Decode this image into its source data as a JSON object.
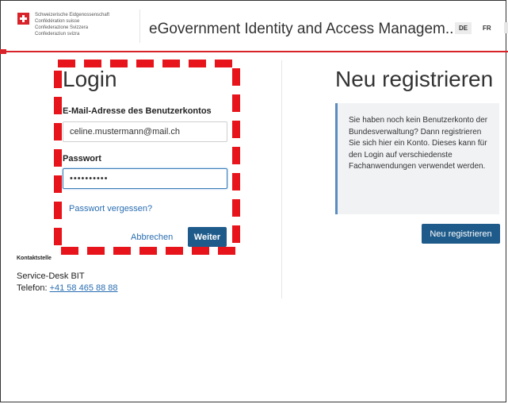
{
  "header": {
    "confederation_lines": [
      "Schweizerische Eidgenossenschaft",
      "Confédération suisse",
      "Confederazione Svizzera",
      "Confederaziun svizra"
    ],
    "app_title": "eGovernment Identity and Access Managem...",
    "languages": [
      "DE",
      "FR"
    ],
    "active_language": "DE"
  },
  "login": {
    "title": "Login",
    "email_label": "E-Mail-Adresse des Benutzerkontos",
    "email_value": "celine.mustermann@mail.ch",
    "password_label": "Passwort",
    "password_value": "••••••••••",
    "forgot_link": "Passwort vergessen?",
    "cancel_link": "Abbrechen",
    "submit_button": "Weiter"
  },
  "contact": {
    "label": "Kontaktstelle",
    "name": "Service-Desk BIT",
    "phone_prefix": "Telefon: ",
    "phone": "+41 58 465 88 88"
  },
  "register": {
    "title": "Neu registrieren",
    "info_text": "Sie haben noch kein Benutzerkonto der Bundesverwaltung? Dann registrieren Sie sich hier ein Konto. Dieses kann für den Login auf verschiedenste Fachanwendungen verwendet werden.",
    "button": "Neu registrieren"
  },
  "colors": {
    "brand_red": "#d8232a",
    "primary_blue": "#1f5b8a",
    "link_blue": "#2a6eb1",
    "highlight_dash": "#e8141b"
  }
}
